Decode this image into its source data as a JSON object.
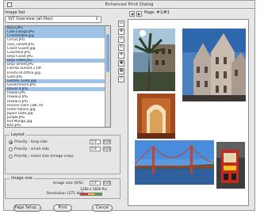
{
  "window": {
    "title": "Enhanced Print Dialog"
  },
  "image_set": {
    "label": "Image Set",
    "selected": "VLT Overview (all files)"
  },
  "file_list": {
    "files": [
      {
        "name": "Bus2.JPG",
        "selected": true
      },
      {
        "name": "Cala Llonga.JPG",
        "selected": true
      },
      {
        "name": "Chantenber.jpg",
        "selected": true
      },
      {
        "name": "Circus.JPG",
        "selected": false
      },
      {
        "name": "cool_casket.JPG",
        "selected": false
      },
      {
        "name": "Coast Guard.jpg",
        "selected": false
      },
      {
        "name": "Coastline.JPG",
        "selected": false
      },
      {
        "name": "Deja Coast.JPG",
        "selected": false
      },
      {
        "name": "Deja Hotel.JPG",
        "selected": true
      },
      {
        "name": "Deja Street.JPG",
        "selected": false
      },
      {
        "name": "Florida Sunset 2.tiff",
        "selected": false
      },
      {
        "name": "Fronts-of-Office.jpg",
        "selected": false
      },
      {
        "name": "Gate.JPG",
        "selected": false
      },
      {
        "name": "Golden_Gate.jpg",
        "selected": true
      },
      {
        "name": "Government.JPG",
        "selected": false
      },
      {
        "name": "Hauss II.JPG",
        "selected": true
      },
      {
        "name": "Hawaii.JPG",
        "selected": false
      },
      {
        "name": "Hawaii2.JPG",
        "selected": false
      },
      {
        "name": "Hawaii3.JPG",
        "selected": false
      },
      {
        "name": "Hoover Dam CBK.TIF",
        "selected": false
      },
      {
        "name": "Hotel Palace.jpg",
        "selected": false
      },
      {
        "name": "Japan Gate.jpg",
        "selected": false
      },
      {
        "name": "Jungle.JPG",
        "selected": false
      },
      {
        "name": "Kid-Mango.jpg",
        "selected": false
      },
      {
        "name": "Kite.JPG",
        "selected": false
      }
    ]
  },
  "layout": {
    "title": "Layout",
    "options": [
      {
        "label": "Priority : long side",
        "checked": true,
        "value": "5.9",
        "unit": "inch"
      },
      {
        "label": "Priority : small side",
        "checked": false,
        "value": "5.9",
        "unit": "inch"
      },
      {
        "label": "Priority : exact size (image crop)",
        "checked": false
      }
    ]
  },
  "image_size": {
    "title": "Image size",
    "size_label": "Image size (R/S):",
    "size_value": "5.9",
    "size_unit": "inch",
    "pixels": "1280 x 1600 Pix",
    "resolution_label": "Resolution (271 dpi)"
  },
  "buttons": {
    "page_setup": "Page Setup...",
    "print": "Print",
    "cancel": "Cancel"
  },
  "preview": {
    "page_label": "Page: #1/#1"
  },
  "icons": {
    "close": "close-box-icon",
    "select_arrows": "up-down-arrows-icon",
    "prev_page": "prev-page-icon",
    "next_page": "next-page-icon",
    "tools": [
      "select-tool-icon",
      "move-tool-icon",
      "zoom-tool-icon",
      "rotate-tool-icon",
      "crop-tool-icon",
      "fit-tool-icon",
      "grid-tool-icon",
      "text-tool-icon"
    ]
  },
  "colors": {
    "list_selection": "#9ec3e6",
    "scroll_thumb": "#7fa9d6"
  }
}
